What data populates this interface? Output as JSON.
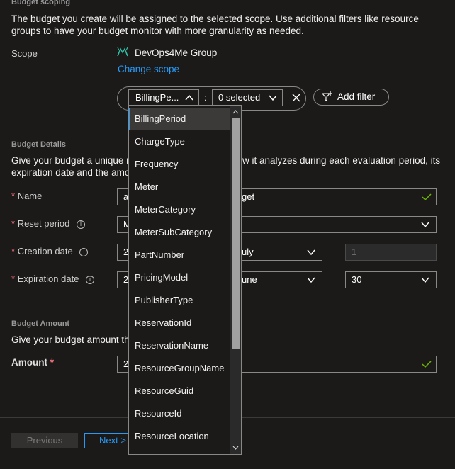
{
  "scoping": {
    "title": "Budget scoping",
    "description_line1": "The budget you create will be assigned to the selected scope. Use additional filters like resource",
    "description_line2": "groups to have your budget monitor with more granularity as needed.",
    "scope_label": "Scope",
    "scope_value": "DevOps4Me Group",
    "change_scope_link": "Change scope"
  },
  "filter": {
    "property_value": "BillingPe...",
    "colon": ":",
    "values_select": "0 selected",
    "add_filter_label": "Add filter"
  },
  "dropdown": {
    "items": [
      "BillingPeriod",
      "ChargeType",
      "Frequency",
      "Meter",
      "MeterCategory",
      "MeterSubCategory",
      "PartNumber",
      "PricingModel",
      "PublisherType",
      "ReservationId",
      "ReservationName",
      "ResourceGroupName",
      "ResourceGuid",
      "ResourceId",
      "ResourceLocation"
    ],
    "selected": "BillingPeriod"
  },
  "details": {
    "title": "Budget Details",
    "description_left1": "Give your budget a unique n",
    "description_right1": "w it analyzes during each evaluation period, its",
    "description_left2": "expiration date and the amo",
    "name_label": "Name",
    "name_value_left": "a",
    "name_value_right": "get",
    "reset_label": "Reset period",
    "reset_value_left": "M",
    "creation_label": "Creation date",
    "creation_value_left": "2",
    "creation_month": "uly",
    "creation_day": "1",
    "expiration_label": "Expiration date",
    "expiration_value_left": "2",
    "expiration_month": "une",
    "expiration_day": "30",
    "required_mark": "*",
    "info_glyph": "i"
  },
  "amount": {
    "title": "Budget Amount",
    "description": "Give your budget amount thi",
    "label": "Amount",
    "value_left": "2"
  },
  "footer": {
    "previous_label": "Previous",
    "next_label": "Next >"
  },
  "colors": {
    "background": "#1b1a19",
    "accent": "#2899f5",
    "required": "#f1707b",
    "valid_check": "#6bb700"
  },
  "icons": {
    "scope": "management-group-icon",
    "add_filter": "add-filter-icon",
    "clear": "close-icon",
    "valid": "checkmark-icon",
    "dropdown": "chevron-down-icon"
  }
}
